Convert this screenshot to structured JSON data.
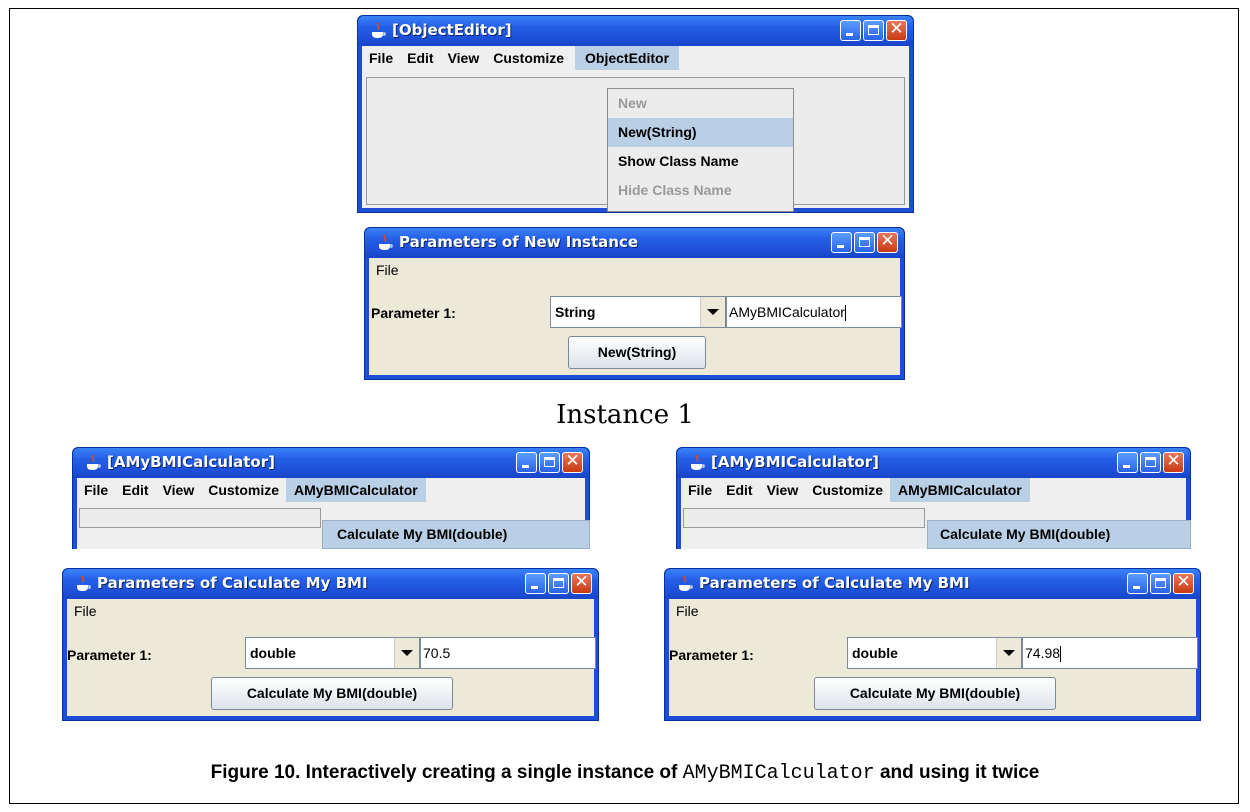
{
  "object_editor_window": {
    "title": "[ObjectEditor]",
    "menu": [
      "File",
      "Edit",
      "View",
      "Customize",
      "ObjectEditor"
    ],
    "dropdown": [
      "New",
      "New(String)",
      "Show Class Name",
      "Hide Class Name"
    ]
  },
  "new_instance_window": {
    "title": "Parameters of New Instance",
    "menu": [
      "File"
    ],
    "param_label": "Parameter 1:",
    "type_value": "String",
    "input_value": "AMyBMICalculator",
    "button_label": "New(String)"
  },
  "instance_label": "Instance 1",
  "bmi_window_left": {
    "title": "[AMyBMICalculator]",
    "menu": [
      "File",
      "Edit",
      "View",
      "Customize",
      "AMyBMICalculator"
    ],
    "submenu_item": "Calculate My BMI(double)"
  },
  "bmi_window_right": {
    "title": "[AMyBMICalculator]",
    "menu": [
      "File",
      "Edit",
      "View",
      "Customize",
      "AMyBMICalculator"
    ],
    "submenu_item": "Calculate My BMI(double)"
  },
  "params_window_left": {
    "title": "Parameters of Calculate My BMI",
    "menu": [
      "File"
    ],
    "param_label": "Parameter 1:",
    "type_value": "double",
    "input_value": "70.5",
    "button_label": "Calculate My BMI(double)"
  },
  "params_window_right": {
    "title": "Parameters of Calculate My BMI",
    "menu": [
      "File"
    ],
    "param_label": "Parameter 1:",
    "type_value": "double",
    "input_value": "74.98",
    "button_label": "Calculate My BMI(double)"
  },
  "figure_caption": {
    "prefix": "Figure 10. Interactively creating a single instance of ",
    "code": "AMyBMICalculator",
    "suffix": " and using it twice"
  },
  "icons": [
    "java-cup-icon",
    "minimize-icon",
    "maximize-icon",
    "close-icon",
    "dropdown-arrow-icon"
  ]
}
